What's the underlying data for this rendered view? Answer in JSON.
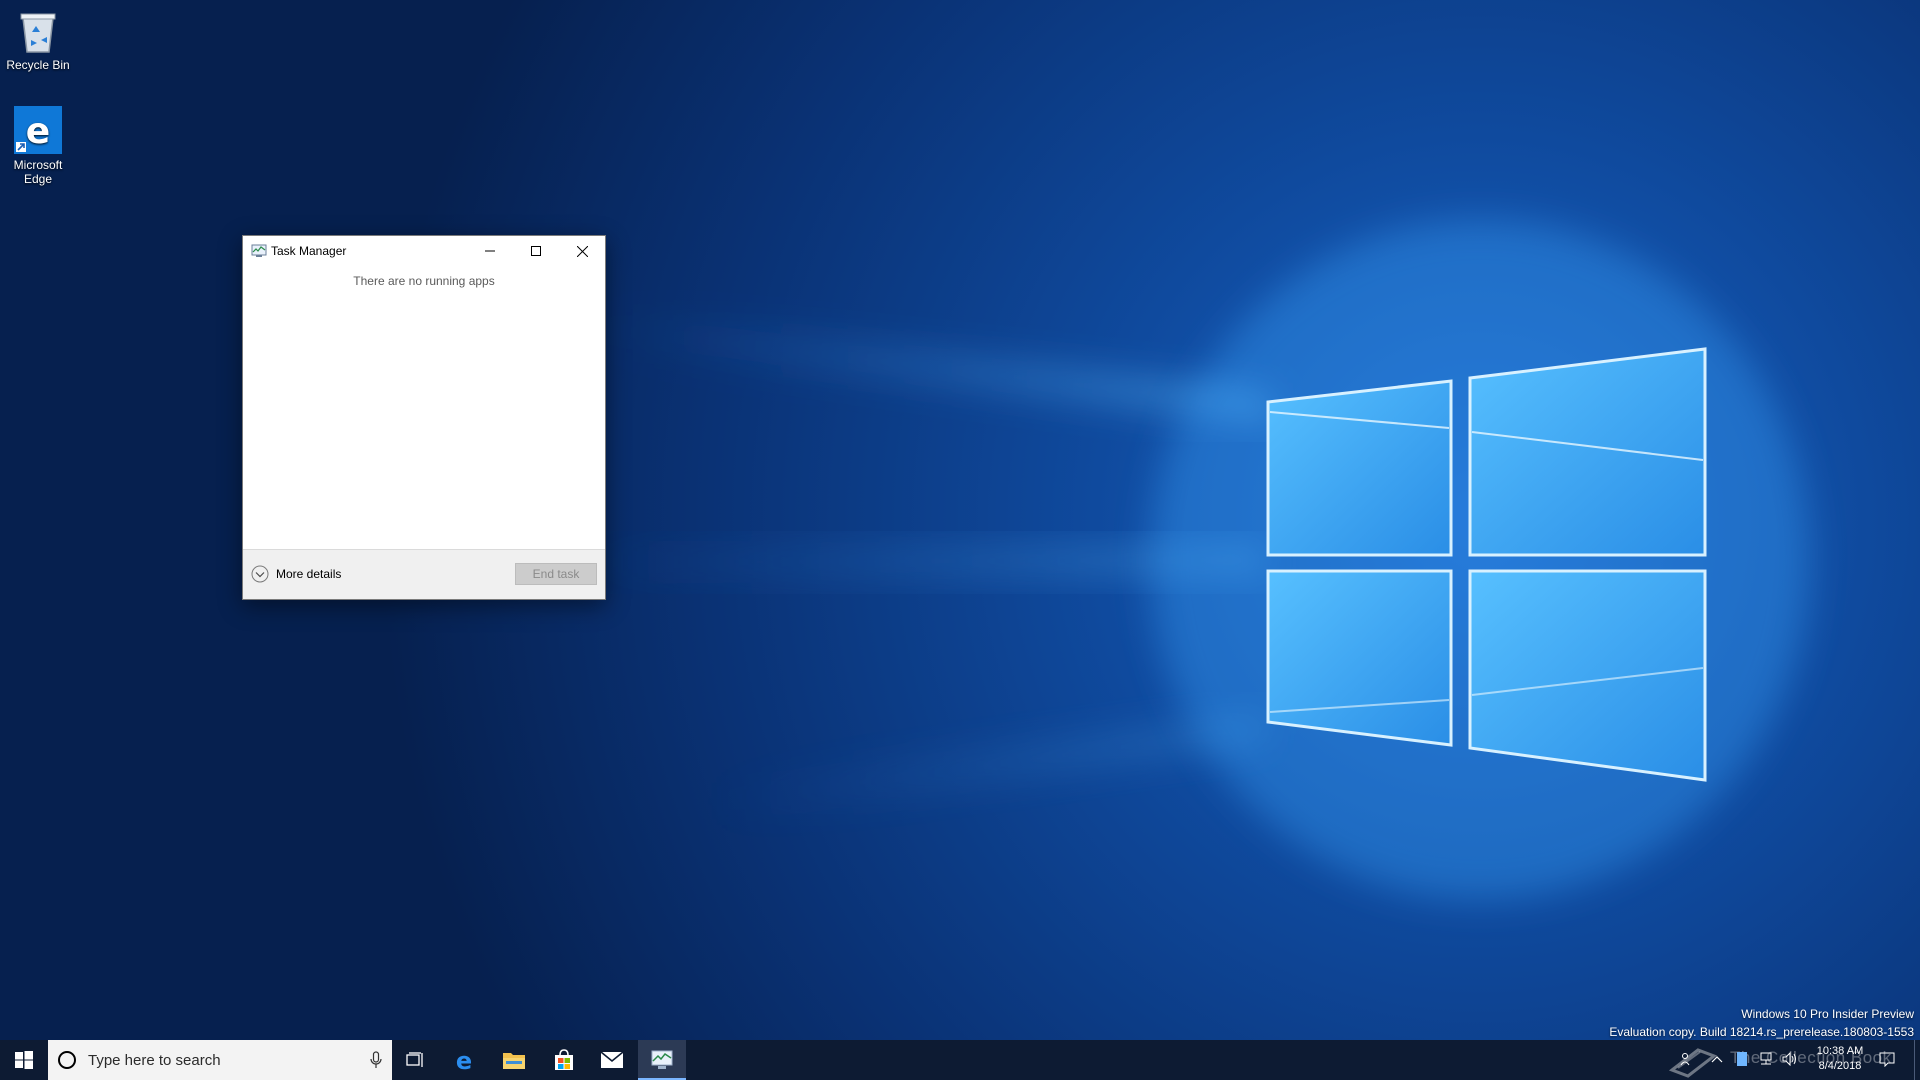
{
  "desktop": {
    "icons": [
      {
        "label": "Recycle Bin",
        "icon": "recycle-bin-icon"
      },
      {
        "label": "Microsoft Edge",
        "icon": "edge-icon"
      }
    ]
  },
  "task_manager": {
    "title": "Task Manager",
    "empty_message": "There are no running apps",
    "more_details_label": "More details",
    "end_task_label": "End task",
    "end_task_enabled": false
  },
  "watermark": {
    "line1": "Windows 10 Pro Insider Preview",
    "line2": "Evaluation copy. Build 18214.rs_prerelease.180803-1553"
  },
  "taskbar": {
    "search_placeholder": "Type here to search",
    "pinned": [
      "task-view-icon",
      "edge-icon",
      "file-explorer-icon",
      "store-icon",
      "mail-icon",
      "task-manager-icon"
    ],
    "active_app": "task-manager-icon",
    "tray": {
      "brand_text": "The Collection Book",
      "time": "10:38 AM",
      "date": "8/4/2018"
    }
  },
  "colors": {
    "taskbar": "#0d1b33",
    "desktop_background": "#0a2a63",
    "window_light": "#4fb0ff",
    "end_task_disabled_bg": "#cccccc",
    "end_task_disabled_text": "#8a8a8a"
  }
}
